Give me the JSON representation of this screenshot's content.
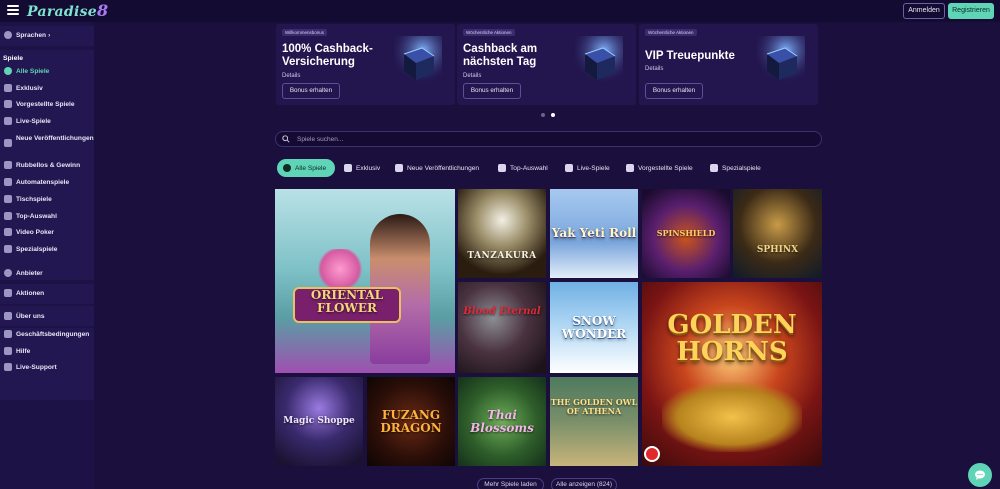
{
  "header": {
    "logo_text": "Paradise",
    "logo_number": "8",
    "login_label": "Anmelden",
    "register_label": "Registrieren"
  },
  "sidebar": {
    "language_label": "Sprachen",
    "section_games": "Spiele",
    "game_items": [
      {
        "label": "Alle Spiele",
        "icon": "horseshoe-icon"
      },
      {
        "label": "Exklusiv",
        "icon": "exclusive-icon"
      },
      {
        "label": "Vorgestellte Spiele",
        "icon": "puzzle-icon"
      },
      {
        "label": "Live-Spiele",
        "icon": "live-dealer-icon"
      },
      {
        "label": "Neue Veröffentlichungen",
        "icon": "new-releases-icon"
      },
      {
        "label": "Rubbellos & Gewinn",
        "icon": "scratch-card-icon"
      },
      {
        "label": "Automatenspiele",
        "icon": "slot-machine-icon"
      },
      {
        "label": "Tischspiele",
        "icon": "table-games-icon"
      },
      {
        "label": "Top-Auswahl",
        "icon": "top-picks-icon"
      },
      {
        "label": "Video Poker",
        "icon": "video-poker-icon"
      },
      {
        "label": "Spezialspiele",
        "icon": "specialty-icon"
      }
    ],
    "providers_label": "Anbieter",
    "promotions_label": "Aktionen",
    "info_items": [
      {
        "label": "Über uns",
        "icon": "about-icon"
      },
      {
        "label": "Geschäftsbedingungen",
        "icon": "terms-icon"
      },
      {
        "label": "Hilfe",
        "icon": "help-icon"
      },
      {
        "label": "Live-Support",
        "icon": "chat-support-icon"
      }
    ]
  },
  "promos": [
    {
      "tag": "Willkommensbonus",
      "title": "100% Cashback-Versicherung",
      "details": "Details",
      "button": "Bonus erhalten"
    },
    {
      "tag": "Wöchentliche Aktionen",
      "title": "Cashback am nächsten Tag",
      "details": "Details",
      "button": "Bonus erhalten"
    },
    {
      "tag": "Wöchentliche Aktionen",
      "title": "VIP Treuepunkte",
      "details": "Details",
      "button": "Bonus erhalten"
    }
  ],
  "search": {
    "placeholder": "Spiele suchen..."
  },
  "tabs": [
    {
      "label": "Alle Spiele",
      "active": true
    },
    {
      "label": "Exklusiv",
      "active": false
    },
    {
      "label": "Neue Veröffentlichungen",
      "active": false
    },
    {
      "label": "Top-Auswahl",
      "active": false
    },
    {
      "label": "Live-Spiele",
      "active": false
    },
    {
      "label": "Vorgestellte Spiele",
      "active": false
    },
    {
      "label": "Spezialspiele",
      "active": false
    }
  ],
  "games": [
    {
      "name": "ORIENTAL FLOWER"
    },
    {
      "name": "TANZAKURA"
    },
    {
      "name": "Yak Yeti Roll"
    },
    {
      "name": "SPINSHIELD"
    },
    {
      "name": "SPHINX"
    },
    {
      "name": "Blood Eternal"
    },
    {
      "name": "SNOW WONDER"
    },
    {
      "name": "GOLDEN HORNS"
    },
    {
      "name": "Magic Shoppe"
    },
    {
      "name": "FUZANG DRAGON"
    },
    {
      "name": "Thai Blossoms"
    },
    {
      "name": "THE GOLDEN OWL OF ATHENA"
    }
  ],
  "footer": {
    "load_more": "Mehr Spiele laden",
    "show_all": "Alle anzeigen (824)"
  },
  "colors": {
    "accent": "#5fd4b6",
    "background": "#1a0f3d",
    "sidebar": "#1c1245"
  }
}
